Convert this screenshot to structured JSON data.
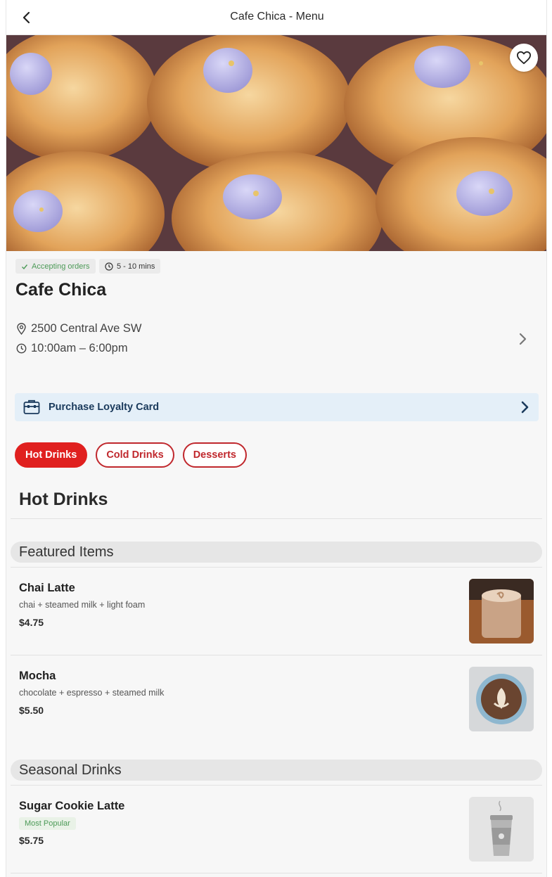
{
  "header": {
    "title": "Cafe Chica - Menu"
  },
  "status": {
    "accepting": "Accepting orders",
    "wait_time": "5 - 10 mins"
  },
  "shop": {
    "name": "Cafe Chica",
    "address": "2500 Central Ave SW",
    "hours": "10:00am – 6:00pm"
  },
  "loyalty": {
    "label": "Purchase Loyalty Card"
  },
  "tabs": [
    {
      "label": "Hot Drinks",
      "active": true
    },
    {
      "label": "Cold Drinks",
      "active": false
    },
    {
      "label": "Desserts",
      "active": false
    }
  ],
  "section": {
    "title": "Hot Drinks"
  },
  "groups": [
    {
      "title": "Featured Items",
      "items": [
        {
          "name": "Chai Latte",
          "description": "chai + steamed milk + light foam",
          "price": "$4.75"
        },
        {
          "name": "Mocha",
          "description": "chocolate + espresso + steamed milk",
          "price": "$5.50"
        }
      ]
    },
    {
      "title": "Seasonal Drinks",
      "items": [
        {
          "name": "Sugar Cookie Latte",
          "badge": "Most Popular",
          "price": "$5.75"
        }
      ]
    }
  ],
  "icons": {
    "back": "chevron-left-icon",
    "favorite": "heart-icon",
    "check": "check-icon",
    "clock": "clock-icon",
    "location": "location-pin-icon",
    "chevron": "chevron-right-icon",
    "card": "wallet-card-icon",
    "cup_placeholder": "coffee-cup-icon"
  },
  "colors": {
    "accent": "#e0201f",
    "accent_border": "#c0282d",
    "loyalty_bg": "#e4eff8",
    "loyalty_text": "#1a3a5c",
    "status_green": "#4c9a57"
  }
}
